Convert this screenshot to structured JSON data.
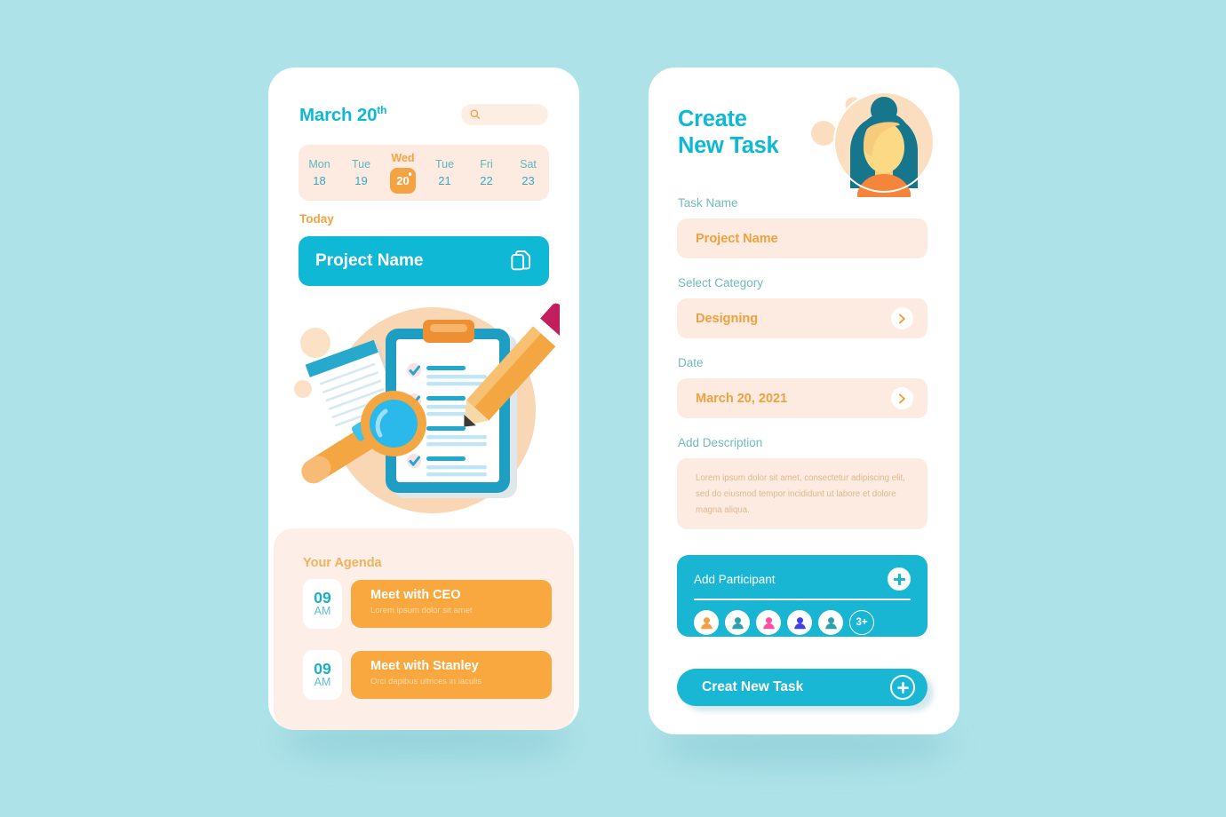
{
  "colors": {
    "background": "#ade2e8",
    "teal": "#0fb8d4",
    "orange": "#f3a342",
    "peach_field": "#fdeae0",
    "peach_panel": "#fdeee7",
    "label_teal": "#6fbcba",
    "card_white": "#ffffff"
  },
  "left_screen": {
    "date_title": "March 20",
    "date_title_suffix": "th",
    "search": {
      "icon": "search-icon",
      "placeholder": "",
      "value": ""
    },
    "daystrip": [
      {
        "name": "Mon",
        "num": "18",
        "active": false
      },
      {
        "name": "Tue",
        "num": "19",
        "active": false
      },
      {
        "name": "Wed",
        "num": "20",
        "active": true
      },
      {
        "name": "Tue",
        "num": "21",
        "active": false
      },
      {
        "name": "Fri",
        "num": "22",
        "active": false
      },
      {
        "name": "Sat",
        "num": "23",
        "active": false
      }
    ],
    "today_label": "Today",
    "project_banner": {
      "label": "Project Name",
      "icon": "copy-documents-icon"
    },
    "illustration": "clipboard-checklist-magnifier-pencil-illustration",
    "agenda": {
      "title": "Your Agenda",
      "items": [
        {
          "hour": "09",
          "ampm": "AM",
          "title": "Meet with CEO",
          "subtitle": "Lorem ipsum dolor sit amet"
        },
        {
          "hour": "09",
          "ampm": "AM",
          "title": "Meet with Stanley",
          "subtitle": "Orci dapibus ultrices in iaculis"
        }
      ]
    }
  },
  "right_screen": {
    "title_line1": "Create",
    "title_line2": "New Task",
    "avatar": "woman-avatar-illustration",
    "fields": {
      "task_name": {
        "label": "Task Name",
        "value": "Project Name"
      },
      "category": {
        "label": "Select Category",
        "value": "Designing",
        "chevron": "chevron-right-icon"
      },
      "date": {
        "label": "Date",
        "value": "March 20, 2021",
        "chevron": "chevron-right-icon"
      },
      "description": {
        "label": "Add Description",
        "value": "Lorem ipsum dolor sit amet, consectetur adipiscing elit, sed do eiusmod tempor incididunt ut labore et dolore magna aliqua."
      }
    },
    "participants": {
      "label": "Add Participant",
      "add_icon": "plus-icon",
      "avatars": [
        {
          "color": "#f2a044"
        },
        {
          "color": "#2e9fae"
        },
        {
          "color": "#fa4fa4"
        },
        {
          "color": "#4242e0"
        },
        {
          "color": "#2e9fae"
        }
      ],
      "more_label": "3+"
    },
    "cta": {
      "label": "Creat New Task",
      "icon": "plus-circle-icon"
    }
  }
}
